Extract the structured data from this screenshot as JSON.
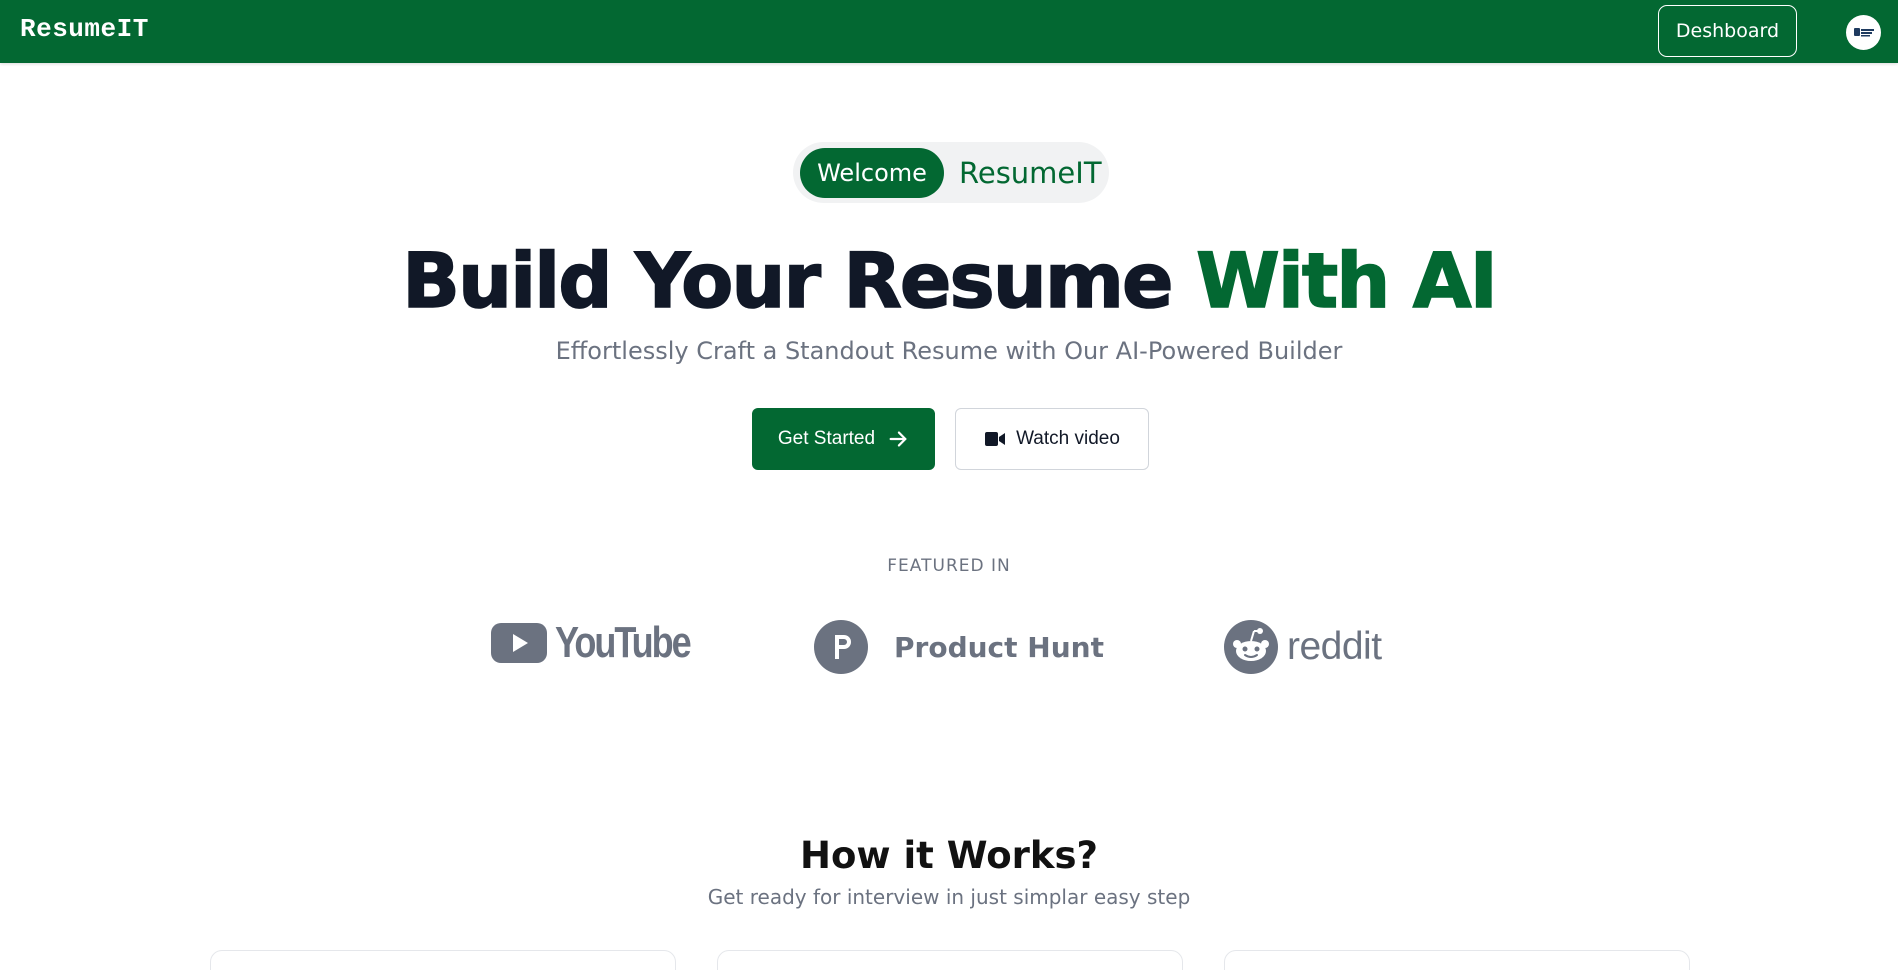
{
  "header": {
    "brand": "ResumeIT",
    "dashboard_label": "Deshboard",
    "background_color": "#036832",
    "avatar_icon": "user-avatar-icon"
  },
  "hero": {
    "pill_welcome": "Welcome",
    "pill_name": "ResumeIT",
    "title_main": "Build Your Resume",
    "title_accent": "With AI",
    "subtitle": "Effortlessly Craft a Standout Resume with Our AI-Powered Builder",
    "primary_button": "Get Started",
    "primary_icon": "arrow-right-icon",
    "secondary_button": "Watch video",
    "secondary_icon": "video-camera-icon",
    "accent_color": "#036832"
  },
  "featured": {
    "label": "FEATURED IN",
    "logos": [
      {
        "name": "YouTube",
        "text": "YouTube",
        "icon": "youtube-icon"
      },
      {
        "name": "Product Hunt",
        "text": "Product Hunt",
        "icon": "product-hunt-icon"
      },
      {
        "name": "reddit",
        "text": "reddit",
        "icon": "reddit-icon"
      }
    ]
  },
  "how_it_works": {
    "title": "How it Works?",
    "subtitle": "Get ready for interview in just simplar easy step"
  }
}
